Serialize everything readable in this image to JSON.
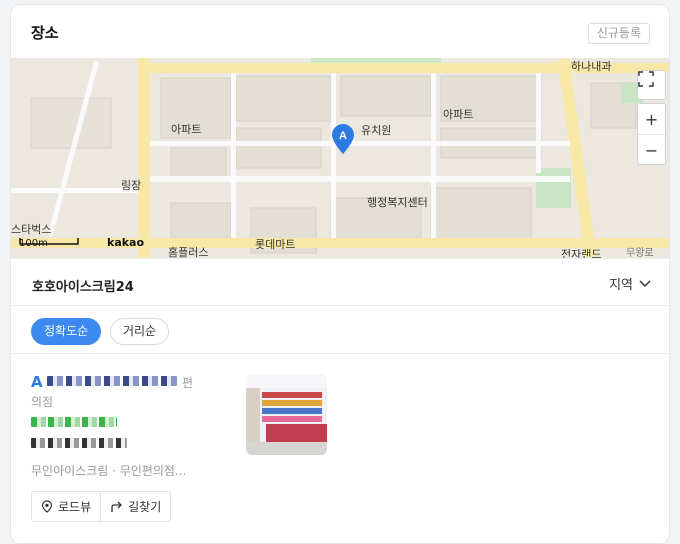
{
  "header": {
    "title": "장소",
    "register_button": "신규등록"
  },
  "map": {
    "labels": {
      "l1": "유치원",
      "l2": "행정복지센터",
      "l3": "롯데마트",
      "l4": "홈플러스",
      "l5": "스타벅스",
      "l6": "전자랜드",
      "l7": "무왕로",
      "l8": "아파트",
      "l9": "아파트",
      "l10": "링장",
      "l11": "하나내과"
    },
    "marker_letter": "A",
    "scale": "100m",
    "provider": "kakao"
  },
  "store_header": {
    "name": "호호아이스크림24",
    "region_label": "지역"
  },
  "sort_options": {
    "accuracy": "정확도순",
    "distance": "거리순"
  },
  "result": {
    "rank": "A",
    "category_suffix_1": "편",
    "category_suffix_2": "의점",
    "tags": "무인아이스크림 · 무인편의점...",
    "roadview_label": "로드뷰",
    "directions_label": "길찾기"
  },
  "colors": {
    "accent": "#3c8af0",
    "rank": "#2c7be5",
    "phone": "#3bb54a"
  }
}
